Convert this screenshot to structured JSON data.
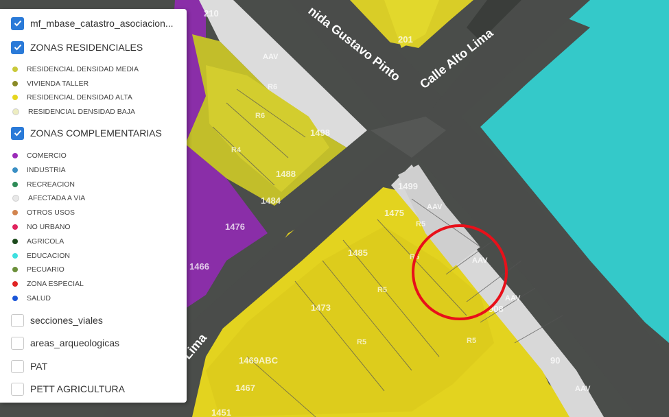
{
  "map": {
    "roads": [
      "nida Gustavo Pinto",
      "Calle Alto Lima",
      "Lima"
    ],
    "parcel_numbers": [
      "210",
      "201",
      "1498",
      "1488",
      "1484",
      "1476",
      "1466",
      "1499",
      "1475",
      "1485",
      "1473",
      "1469ABC",
      "1467",
      "1451",
      "90",
      "908"
    ],
    "zone_codes": [
      "AAV",
      "R6",
      "R6",
      "R4",
      "R5",
      "R5",
      "R5",
      "R5",
      "R5",
      "AAV",
      "AAV",
      "AAV",
      "AAV"
    ],
    "highlight_color": "#e8101a"
  },
  "legend": {
    "layers": [
      {
        "label": "mf_mbase_catastro_asociacion...",
        "checked": true
      },
      {
        "label": "ZONAS RESIDENCIALES",
        "checked": true
      },
      {
        "label": "ZONAS COMPLEMENTARIAS",
        "checked": true
      },
      {
        "label": "secciones_viales",
        "checked": false
      },
      {
        "label": "areas_arqueologicas",
        "checked": false
      },
      {
        "label": "PAT",
        "checked": false
      },
      {
        "label": "PETT AGRICULTURA",
        "checked": false
      }
    ],
    "residenciales": [
      {
        "label": "RESIDENCIAL DENSIDAD MEDIA",
        "color": "#c9c93a"
      },
      {
        "label": "VIVIENDA TALLER",
        "color": "#8a8a26"
      },
      {
        "label": "RESIDENCIAL DENSIDAD ALTA",
        "color": "#e6d61e"
      },
      {
        "label": "RESIDENCIAL DENSIDAD BAJA",
        "color": "#ededc0"
      }
    ],
    "complementarias": [
      {
        "label": "COMERCIO",
        "color": "#9b2bb8"
      },
      {
        "label": "INDUSTRIA",
        "color": "#3a8fc4"
      },
      {
        "label": "RECREACION",
        "color": "#2e8b57"
      },
      {
        "label": "AFECTADA A VIA",
        "color": "#e8e8e8"
      },
      {
        "label": "OTROS USOS",
        "color": "#d2844f"
      },
      {
        "label": "NO URBANO",
        "color": "#e0245e"
      },
      {
        "label": "AGRICOLA",
        "color": "#1c4a1c"
      },
      {
        "label": "EDUCACION",
        "color": "#3ee0e0"
      },
      {
        "label": "PECUARIO",
        "color": "#6b8f3a"
      },
      {
        "label": "ZONA ESPECIAL",
        "color": "#e02424"
      },
      {
        "label": "SALUD",
        "color": "#1a56d8"
      }
    ]
  }
}
